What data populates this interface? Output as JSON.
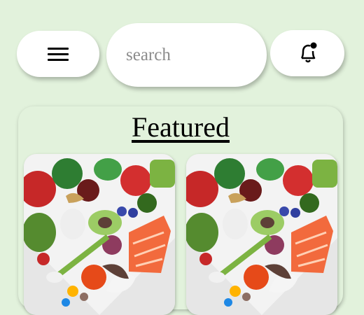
{
  "topbar": {
    "menu_icon": "hamburger-menu-icon",
    "search_placeholder": "search",
    "notification_icon": "bell-notification-icon"
  },
  "featured": {
    "title": "Featured",
    "cards": [
      {
        "image": "vegetables-salmon-heart-image"
      },
      {
        "image": "vegetables-salmon-heart-image"
      }
    ]
  },
  "colors": {
    "background": "#e2f2dc",
    "pill": "#ffffff",
    "card_bg": "#e4e4e4"
  }
}
